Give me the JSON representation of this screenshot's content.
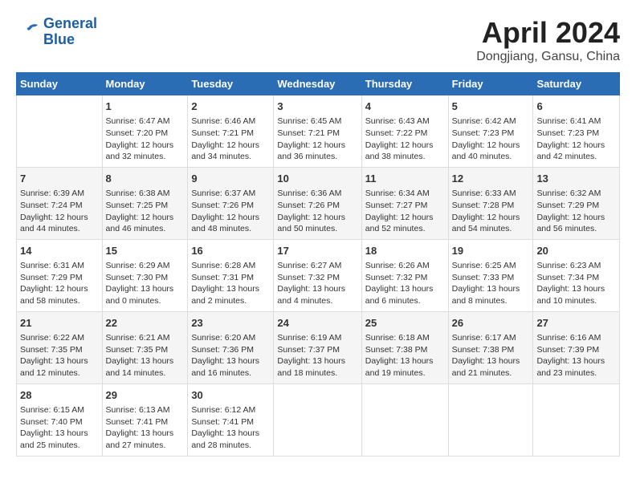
{
  "header": {
    "logo_line1": "General",
    "logo_line2": "Blue",
    "month_title": "April 2024",
    "location": "Dongjiang, Gansu, China"
  },
  "weekdays": [
    "Sunday",
    "Monday",
    "Tuesday",
    "Wednesday",
    "Thursday",
    "Friday",
    "Saturday"
  ],
  "weeks": [
    [
      {
        "day": "",
        "info": ""
      },
      {
        "day": "1",
        "info": "Sunrise: 6:47 AM\nSunset: 7:20 PM\nDaylight: 12 hours\nand 32 minutes."
      },
      {
        "day": "2",
        "info": "Sunrise: 6:46 AM\nSunset: 7:21 PM\nDaylight: 12 hours\nand 34 minutes."
      },
      {
        "day": "3",
        "info": "Sunrise: 6:45 AM\nSunset: 7:21 PM\nDaylight: 12 hours\nand 36 minutes."
      },
      {
        "day": "4",
        "info": "Sunrise: 6:43 AM\nSunset: 7:22 PM\nDaylight: 12 hours\nand 38 minutes."
      },
      {
        "day": "5",
        "info": "Sunrise: 6:42 AM\nSunset: 7:23 PM\nDaylight: 12 hours\nand 40 minutes."
      },
      {
        "day": "6",
        "info": "Sunrise: 6:41 AM\nSunset: 7:23 PM\nDaylight: 12 hours\nand 42 minutes."
      }
    ],
    [
      {
        "day": "7",
        "info": "Sunrise: 6:39 AM\nSunset: 7:24 PM\nDaylight: 12 hours\nand 44 minutes."
      },
      {
        "day": "8",
        "info": "Sunrise: 6:38 AM\nSunset: 7:25 PM\nDaylight: 12 hours\nand 46 minutes."
      },
      {
        "day": "9",
        "info": "Sunrise: 6:37 AM\nSunset: 7:26 PM\nDaylight: 12 hours\nand 48 minutes."
      },
      {
        "day": "10",
        "info": "Sunrise: 6:36 AM\nSunset: 7:26 PM\nDaylight: 12 hours\nand 50 minutes."
      },
      {
        "day": "11",
        "info": "Sunrise: 6:34 AM\nSunset: 7:27 PM\nDaylight: 12 hours\nand 52 minutes."
      },
      {
        "day": "12",
        "info": "Sunrise: 6:33 AM\nSunset: 7:28 PM\nDaylight: 12 hours\nand 54 minutes."
      },
      {
        "day": "13",
        "info": "Sunrise: 6:32 AM\nSunset: 7:29 PM\nDaylight: 12 hours\nand 56 minutes."
      }
    ],
    [
      {
        "day": "14",
        "info": "Sunrise: 6:31 AM\nSunset: 7:29 PM\nDaylight: 12 hours\nand 58 minutes."
      },
      {
        "day": "15",
        "info": "Sunrise: 6:29 AM\nSunset: 7:30 PM\nDaylight: 13 hours\nand 0 minutes."
      },
      {
        "day": "16",
        "info": "Sunrise: 6:28 AM\nSunset: 7:31 PM\nDaylight: 13 hours\nand 2 minutes."
      },
      {
        "day": "17",
        "info": "Sunrise: 6:27 AM\nSunset: 7:32 PM\nDaylight: 13 hours\nand 4 minutes."
      },
      {
        "day": "18",
        "info": "Sunrise: 6:26 AM\nSunset: 7:32 PM\nDaylight: 13 hours\nand 6 minutes."
      },
      {
        "day": "19",
        "info": "Sunrise: 6:25 AM\nSunset: 7:33 PM\nDaylight: 13 hours\nand 8 minutes."
      },
      {
        "day": "20",
        "info": "Sunrise: 6:23 AM\nSunset: 7:34 PM\nDaylight: 13 hours\nand 10 minutes."
      }
    ],
    [
      {
        "day": "21",
        "info": "Sunrise: 6:22 AM\nSunset: 7:35 PM\nDaylight: 13 hours\nand 12 minutes."
      },
      {
        "day": "22",
        "info": "Sunrise: 6:21 AM\nSunset: 7:35 PM\nDaylight: 13 hours\nand 14 minutes."
      },
      {
        "day": "23",
        "info": "Sunrise: 6:20 AM\nSunset: 7:36 PM\nDaylight: 13 hours\nand 16 minutes."
      },
      {
        "day": "24",
        "info": "Sunrise: 6:19 AM\nSunset: 7:37 PM\nDaylight: 13 hours\nand 18 minutes."
      },
      {
        "day": "25",
        "info": "Sunrise: 6:18 AM\nSunset: 7:38 PM\nDaylight: 13 hours\nand 19 minutes."
      },
      {
        "day": "26",
        "info": "Sunrise: 6:17 AM\nSunset: 7:38 PM\nDaylight: 13 hours\nand 21 minutes."
      },
      {
        "day": "27",
        "info": "Sunrise: 6:16 AM\nSunset: 7:39 PM\nDaylight: 13 hours\nand 23 minutes."
      }
    ],
    [
      {
        "day": "28",
        "info": "Sunrise: 6:15 AM\nSunset: 7:40 PM\nDaylight: 13 hours\nand 25 minutes."
      },
      {
        "day": "29",
        "info": "Sunrise: 6:13 AM\nSunset: 7:41 PM\nDaylight: 13 hours\nand 27 minutes."
      },
      {
        "day": "30",
        "info": "Sunrise: 6:12 AM\nSunset: 7:41 PM\nDaylight: 13 hours\nand 28 minutes."
      },
      {
        "day": "",
        "info": ""
      },
      {
        "day": "",
        "info": ""
      },
      {
        "day": "",
        "info": ""
      },
      {
        "day": "",
        "info": ""
      }
    ]
  ]
}
